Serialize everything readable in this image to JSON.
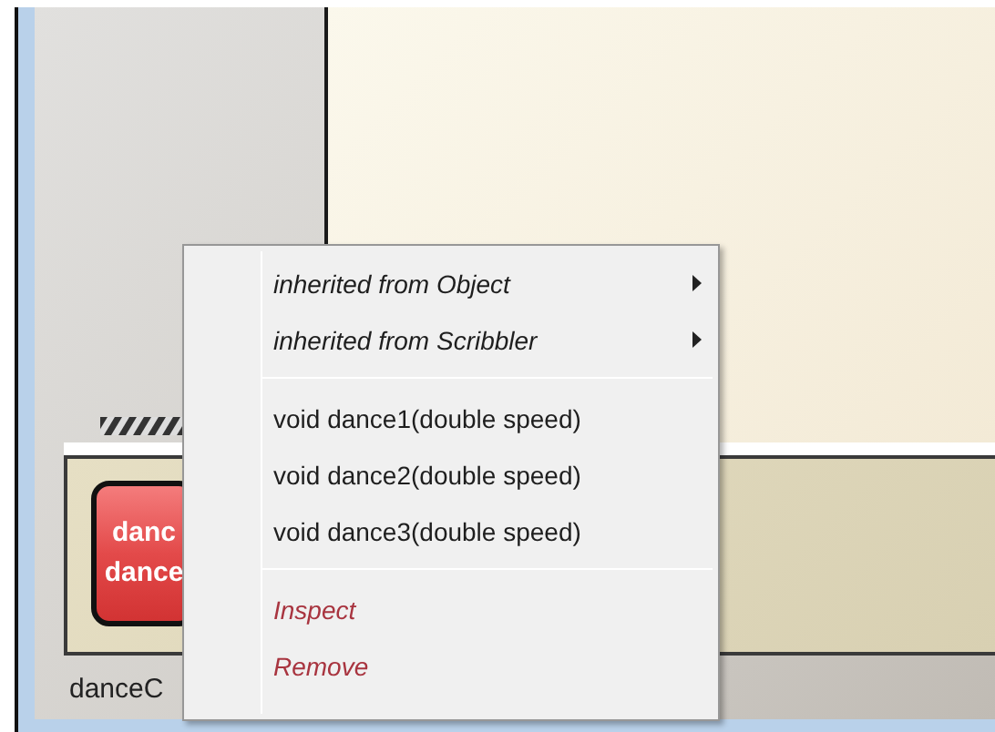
{
  "object_bench": {
    "objects": [
      {
        "button_lines": [
          "danc",
          "dance"
        ],
        "name": "danceC"
      }
    ]
  },
  "context_menu": {
    "items": [
      {
        "kind": "submenu",
        "label": "inherited from Object"
      },
      {
        "kind": "submenu",
        "label": "inherited from Scribbler"
      },
      {
        "kind": "separator"
      },
      {
        "kind": "method",
        "label": "void dance1(double speed)"
      },
      {
        "kind": "method",
        "label": "void dance2(double speed)"
      },
      {
        "kind": "method",
        "label": "void dance3(double speed)"
      },
      {
        "kind": "separator"
      },
      {
        "kind": "action",
        "label": "Inspect"
      },
      {
        "kind": "action",
        "label": "Remove"
      }
    ]
  }
}
